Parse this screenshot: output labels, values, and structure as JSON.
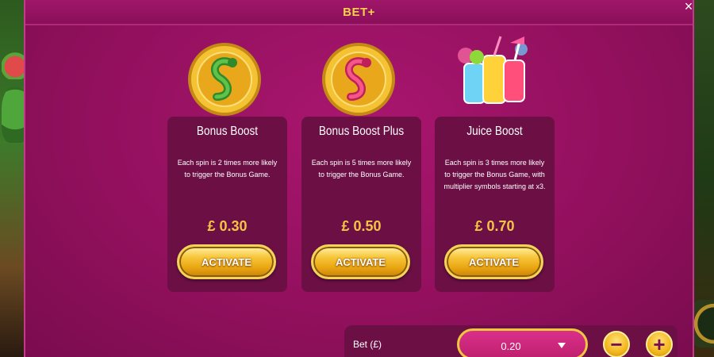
{
  "header": {
    "title": "BET+",
    "close_glyph": "×"
  },
  "cards": [
    {
      "title": "Bonus Boost",
      "description": "Each spin is 2 times more likely to trigger the Bonus Game.",
      "price": "£ 0.30",
      "button_label": "ACTIVATE",
      "icon": "green-snake-coin-icon"
    },
    {
      "title": "Bonus Boost Plus",
      "description": "Each spin is 5 times more likely to trigger the Bonus Game.",
      "price": "£ 0.50",
      "button_label": "ACTIVATE",
      "icon": "pink-snake-coin-icon"
    },
    {
      "title": "Juice Boost",
      "description": "Each spin is 3 times more likely to trigger the Bonus Game, with multiplier symbols starting at x3.",
      "price": "£ 0.70",
      "button_label": "ACTIVATE",
      "icon": "juice-drinks-icon"
    }
  ],
  "bet": {
    "label": "Bet (£)",
    "value": "0.20",
    "minus": "−",
    "plus": "+"
  },
  "colors": {
    "modal_bg": "#93105e",
    "card_bg": "#6b0f45",
    "gold": "#f6c445",
    "title_gold": "#f6d24a"
  }
}
